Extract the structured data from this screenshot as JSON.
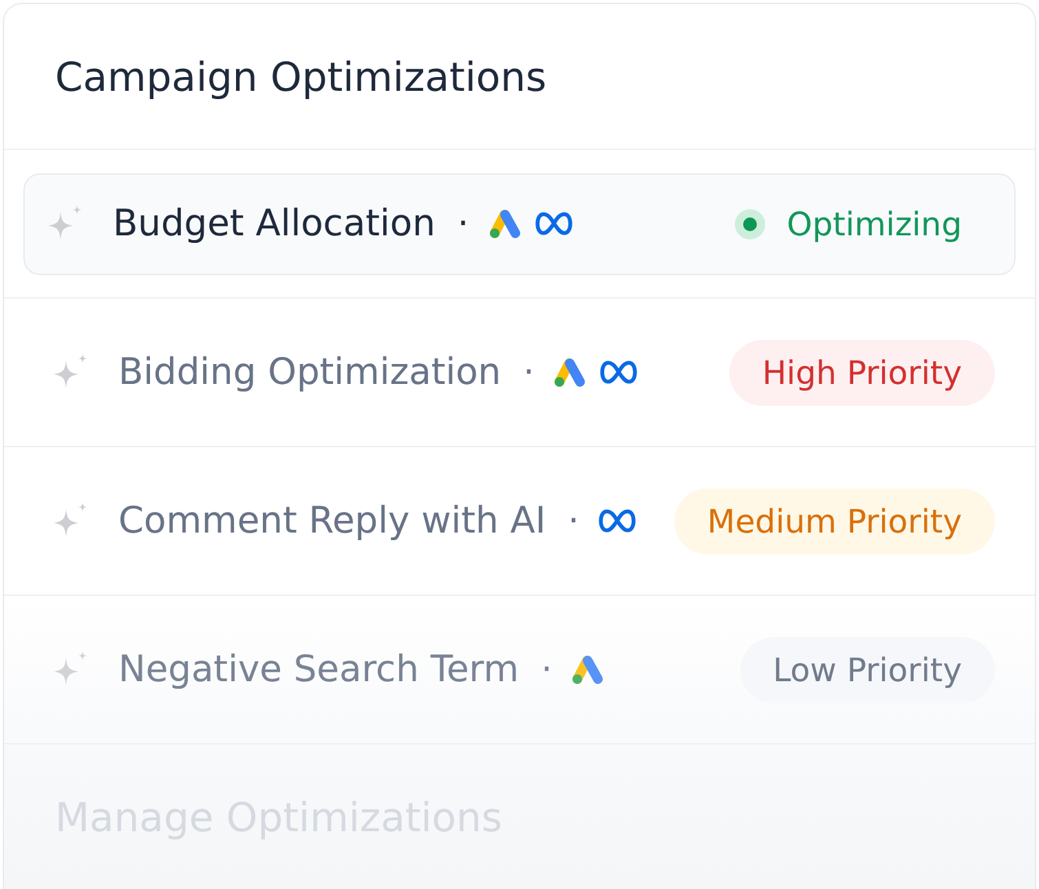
{
  "panel": {
    "title": "Campaign Optimizations"
  },
  "rows": [
    {
      "label": "Budget Allocation",
      "selected": true,
      "separator": "·",
      "platforms": [
        {
          "kind": "google_ads"
        },
        {
          "kind": "meta"
        }
      ],
      "status": {
        "kind": "optimizing",
        "label": "Optimizing"
      }
    },
    {
      "label": "Bidding Optimization",
      "selected": false,
      "separator": "·",
      "platforms": [
        {
          "kind": "google_ads"
        },
        {
          "kind": "meta"
        }
      ],
      "status": {
        "kind": "high",
        "label": "High Priority"
      }
    },
    {
      "label": "Comment Reply with AI",
      "selected": false,
      "separator": "·",
      "platforms": [
        {
          "kind": "meta"
        }
      ],
      "status": {
        "kind": "medium",
        "label": "Medium Priority"
      }
    },
    {
      "label": "Negative Search Term",
      "selected": false,
      "separator": "·",
      "platforms": [
        {
          "kind": "google_ads"
        }
      ],
      "status": {
        "kind": "low",
        "label": "Low Priority"
      }
    }
  ],
  "footer": {
    "link": "Manage Optimizations"
  }
}
